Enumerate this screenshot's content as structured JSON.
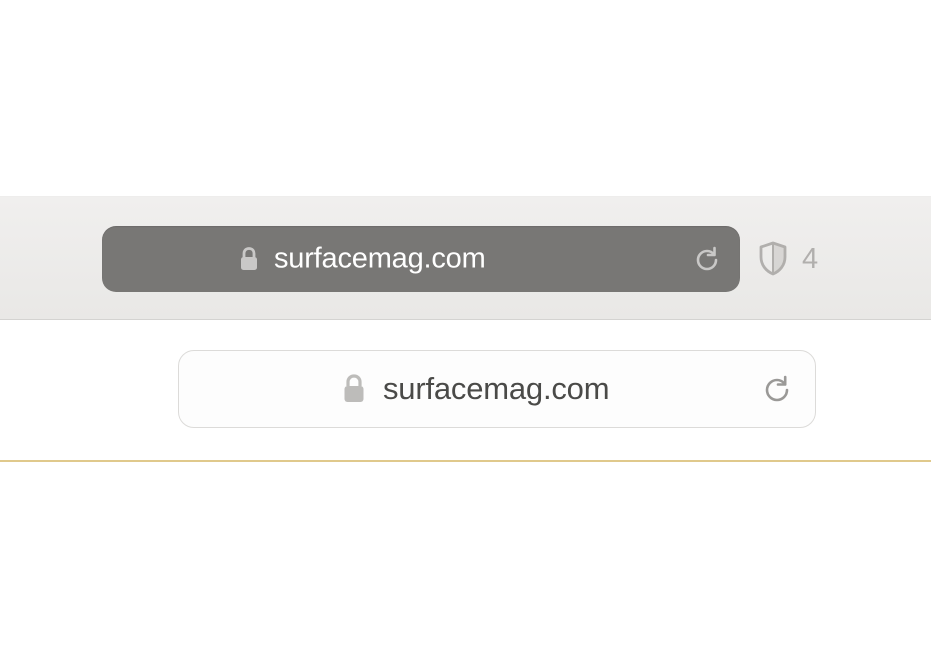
{
  "top_bar": {
    "url": "surfacemag.com",
    "privacy_count": "4"
  },
  "secondary_bar": {
    "url": "surfacemag.com"
  }
}
